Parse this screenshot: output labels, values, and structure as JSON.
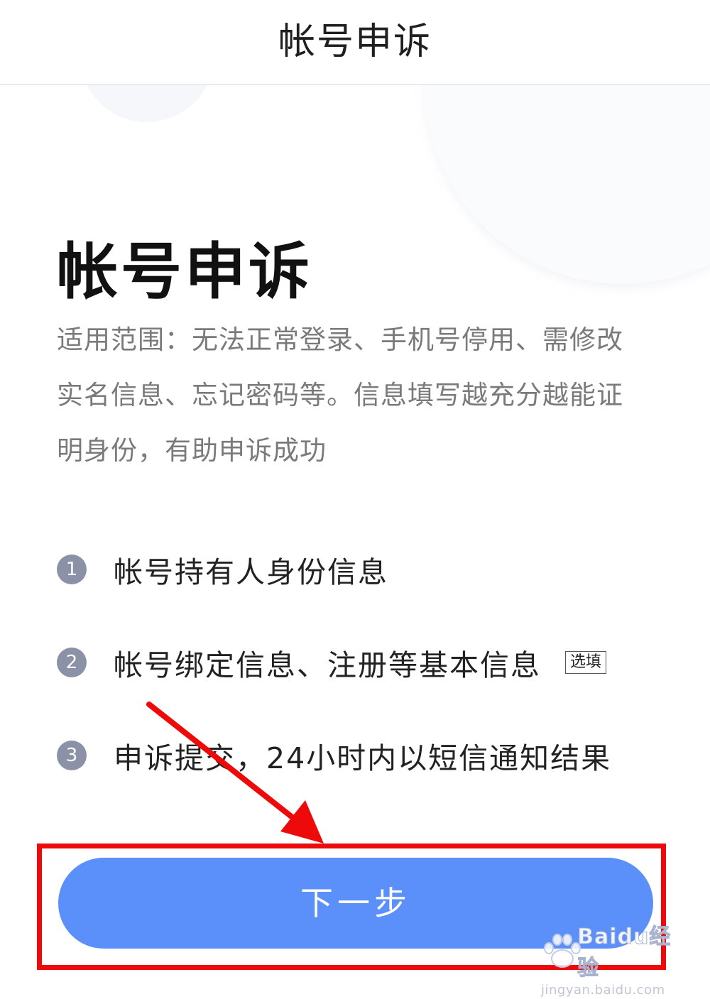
{
  "header": {
    "title": "帐号申诉"
  },
  "main": {
    "title": "帐号申诉",
    "scope_text": "适用范围：无法正常登录、手机号停用、需修改实名信息、忘记密码等。信息填写越充分越能证明身份，有助申诉成功"
  },
  "steps": [
    {
      "number": "1",
      "text": "帐号持有人身份信息",
      "tag": ""
    },
    {
      "number": "2",
      "text": "帐号绑定信息、注册等基本信息",
      "tag": "选填"
    },
    {
      "number": "3",
      "text": "申诉提交，24小时内以短信通知结果",
      "tag": ""
    }
  ],
  "actions": {
    "next_label": "下一步"
  },
  "watermark": {
    "brand": "Baidu经验",
    "url": "jingyan.baidu.com"
  },
  "colors": {
    "button": "#5b8ff9",
    "annotation": "#ee0a0a",
    "step_badge": "#8b92a7"
  },
  "icons": {
    "annotation_arrow": "arrow-icon",
    "watermark_logo": "baidu-paw-icon"
  }
}
